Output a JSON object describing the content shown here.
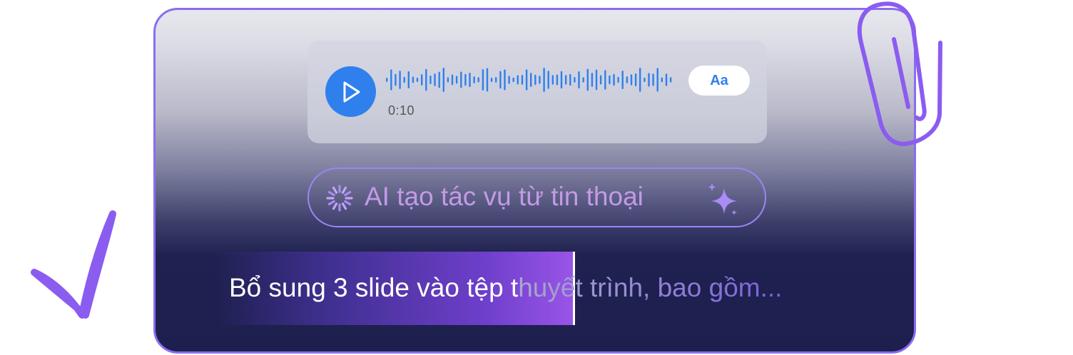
{
  "voice_message": {
    "duration": "0:10",
    "text_toggle_label": "Aa",
    "play_icon": "play-icon",
    "accent_color": "#2f80ed"
  },
  "ai_action": {
    "label": "AI tạo tác vụ từ tin thoại",
    "status_icon": "loading-spinner-icon",
    "decoration_icon": "sparkle-icon",
    "border_color": "#9a86f5"
  },
  "transcript": {
    "typed_text": "Bổ sung 3 slide vào tệp t",
    "pending_text": "huyết trình, bao gồm..."
  },
  "decorations": {
    "checkmark_icon": "checkmark-icon",
    "paperclip_icon": "paperclip-icon",
    "accent_purple": "#8b5cf0"
  }
}
